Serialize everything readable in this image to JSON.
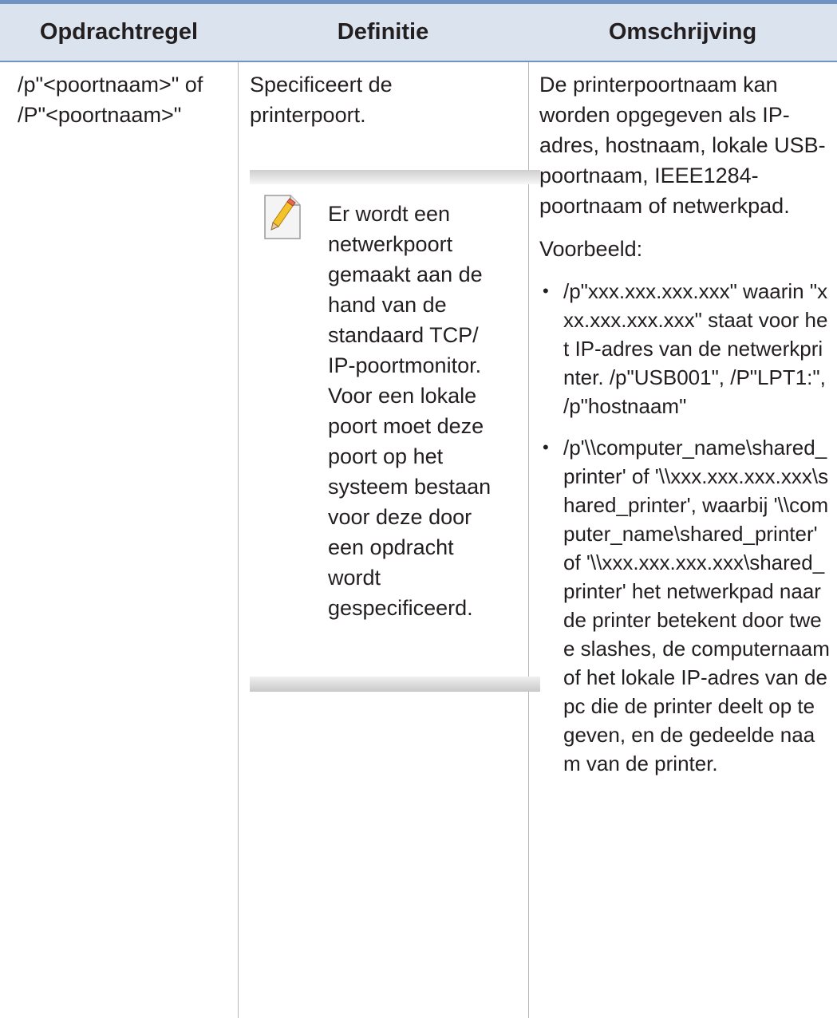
{
  "table": {
    "headers": {
      "command": "Opdrachtregel",
      "definition": "Definitie",
      "description": "Omschrijving"
    },
    "row": {
      "command_lines": [
        "/p\"<poortnaam>\" of",
        "/P\"<poortnaam>\""
      ],
      "definition_lines": [
        "Specificeert de",
        "printerpoort."
      ],
      "note": {
        "icon": "note-pencil-icon",
        "lines": [
          "Er wordt een",
          "netwerkpoort",
          "gemaakt aan de",
          "hand van de",
          "standaard TCP/",
          "IP-poortmonitor.",
          "Voor een lokale",
          "poort moet deze",
          "poort op het",
          "systeem bestaan",
          "voor deze door",
          "een opdracht",
          "wordt",
          "gespecificeerd."
        ]
      },
      "description": {
        "intro": "De printerpoortnaam kan worden opgegeven als IP-adres, hostnaam, lokale USB-poortnaam, IEEE1284-poortnaam of netwerkpad.",
        "example_label": "Voorbeeld:",
        "bullets": [
          "/p\"xxx.xxx.xxx.xxx\" waarin \"xxx.xxx.xxx.xxx\" staat voor het IP-adres van de netwerkprinter. /p\"USB001\", /P\"LPT1:\", /p\"hostnaam\"",
          "/p'\\\\computer_name\\shared_printer' of '\\\\xxx.xxx.xxx.xxx\\shared_printer', waarbij '\\\\computer_name\\shared_printer' of '\\\\xxx.xxx.xxx.xxx\\shared_printer' het netwerkpad naar de printer betekent door twee slashes, de computernaam of het lokale IP-adres van de pc die de printer deelt op te geven, en de gedeelde naam van de printer."
        ]
      }
    }
  },
  "colors": {
    "header_bg": "#dbe3ee",
    "rule": "#6f94c4",
    "text": "#231f20",
    "grid": "#b8b8b8"
  }
}
